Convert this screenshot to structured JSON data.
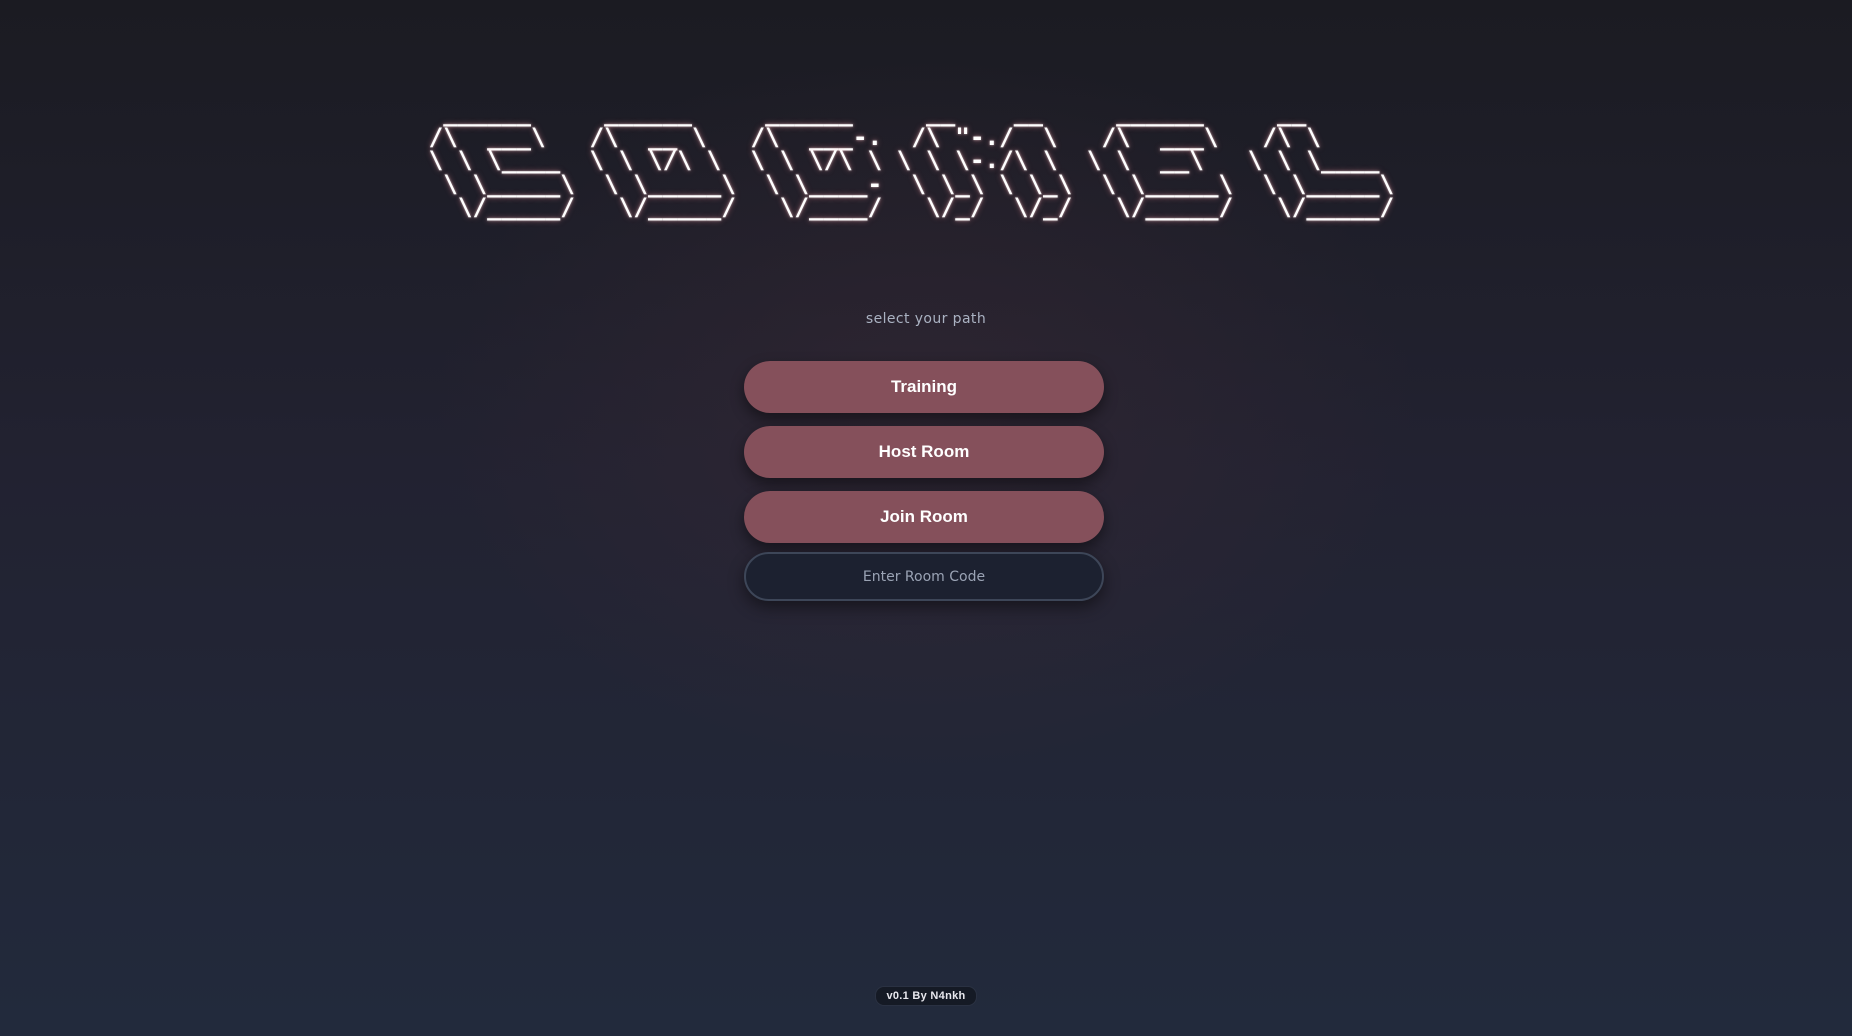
{
  "logo": {
    "ascii_art": " ______     ______     ______     __    __     ______     __        \n/\\  ___\\   /\\  __ \\   /\\  ___-.  /\\ \"-./  \\   /\\  ___\\   /\\ \\       \n\\ \\ \\____  \\ \\ \\/\\ \\  \\ \\ \\/\\ \\ \\ \\ \\-./\\ \\  \\ \\  __\\   \\ \\ \\____  \n \\ \\_____\\  \\ \\_____\\  \\ \\____-  \\ \\_\\ \\ \\_\\  \\ \\_____\\  \\ \\_____\\ \n  \\/_____/   \\/_____/   \\/____/   \\/_/  \\/_/   \\/_____/   \\/_____/ "
  },
  "subtitle": "select your path",
  "menu": {
    "training_label": "Training",
    "host_label": "Host Room",
    "join_label": "Join Room",
    "room_code_placeholder": "Enter Room Code",
    "room_code_value": ""
  },
  "footer": {
    "version": "v0.1 By N4nkh"
  },
  "colors": {
    "button_bg": "#85505b",
    "input_bg": "#1c2130",
    "input_border": "#3d4658",
    "subtitle": "#aab2c2"
  }
}
